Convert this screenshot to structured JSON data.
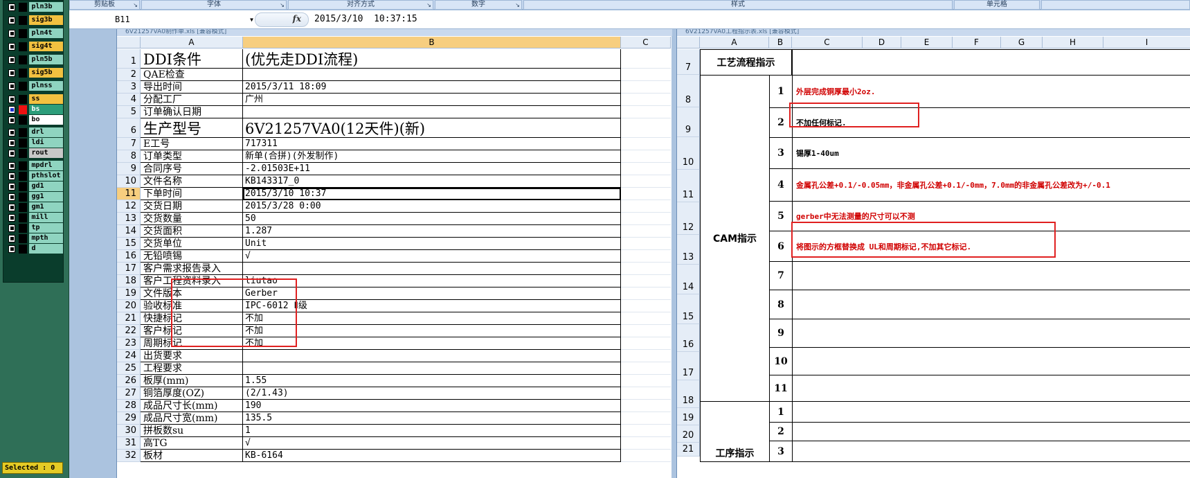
{
  "layers": {
    "items": [
      {
        "name": "pln3b",
        "style": "plain"
      },
      {
        "name": "sig3b",
        "style": "yel"
      },
      {
        "name": "pln4t",
        "style": "plain"
      },
      {
        "name": "sig4t",
        "style": "yel"
      },
      {
        "name": "pln5b",
        "style": "plain"
      },
      {
        "name": "sig5b",
        "style": "yel"
      },
      {
        "name": "plnss",
        "style": "plain"
      },
      {
        "name": "ss",
        "style": "yel"
      },
      {
        "name": "bs",
        "style": "grn"
      },
      {
        "name": "bo",
        "style": "wht"
      },
      {
        "name": "drl",
        "style": "plain"
      },
      {
        "name": "ldi",
        "style": "plain"
      },
      {
        "name": "rout",
        "style": "gry"
      },
      {
        "name": "mpdrl",
        "style": "plain"
      },
      {
        "name": "pthslot",
        "style": "plain"
      },
      {
        "name": "gd1",
        "style": "plain"
      },
      {
        "name": "gg1",
        "style": "plain"
      },
      {
        "name": "gm1",
        "style": "plain"
      },
      {
        "name": "mill",
        "style": "plain"
      },
      {
        "name": "tp",
        "style": "plain"
      },
      {
        "name": "mpth",
        "style": "plain"
      },
      {
        "name": "d",
        "style": "plain"
      }
    ],
    "selected_text": "Selected : 0"
  },
  "ribbon": {
    "groups": [
      "剪贴板",
      "字体",
      "对齐方式",
      "数字",
      "样式",
      "单元格"
    ]
  },
  "formula_bar": {
    "name_box": "B11",
    "fx": "fx",
    "value": "2015/3/10  10:37:15"
  },
  "left_sheet": {
    "window_title": "6V21257VA0制作单.xls  [兼容模式]",
    "columns": [
      "A",
      "B",
      "C"
    ],
    "rows": [
      {
        "n": "1",
        "a": "DDI条件",
        "b": "(优先走DDI流程)",
        "big": true
      },
      {
        "n": "2",
        "a": "QAE检查",
        "b": ""
      },
      {
        "n": "3",
        "a": "导出时间",
        "b": "2015/3/11 18:09"
      },
      {
        "n": "4",
        "a": "分配工厂",
        "b": "广州"
      },
      {
        "n": "5",
        "a": "订单确认日期",
        "b": ""
      },
      {
        "n": "6",
        "a": "生产型号",
        "b": "6V21257VA0(12天件)(新)",
        "big": true
      },
      {
        "n": "7",
        "a": "E工号",
        "b": "717311"
      },
      {
        "n": "8",
        "a": "订单类型",
        "b": "新单(合拼)(外发制作)"
      },
      {
        "n": "9",
        "a": "合同序号",
        "b": "-2.01503E+11"
      },
      {
        "n": "10",
        "a": "文件名称",
        "b": "KB143317_0"
      },
      {
        "n": "11",
        "a": "下单时间",
        "b": "2015/3/10 10:37",
        "sel": true
      },
      {
        "n": "12",
        "a": "交货日期",
        "b": "2015/3/28 0:00"
      },
      {
        "n": "13",
        "a": "交货数量",
        "b": "50"
      },
      {
        "n": "14",
        "a": "交货面积",
        "b": "1.287"
      },
      {
        "n": "15",
        "a": "交货单位",
        "b": "Unit"
      },
      {
        "n": "16",
        "a": "无铅喷锡",
        "b": "√"
      },
      {
        "n": "17",
        "a": "客户需求报告录入",
        "b": ""
      },
      {
        "n": "18",
        "a": "客户工程资料录入",
        "b": "liutao"
      },
      {
        "n": "19",
        "a": "文件版本",
        "b": "Gerber"
      },
      {
        "n": "20",
        "a": "验收标准",
        "b": "IPC-6012 Ⅱ级"
      },
      {
        "n": "21",
        "a": "快捷标记",
        "b": "不加"
      },
      {
        "n": "22",
        "a": "客户标记",
        "b": "不加"
      },
      {
        "n": "23",
        "a": "周期标记",
        "b": "不加"
      },
      {
        "n": "24",
        "a": "出货要求",
        "b": ""
      },
      {
        "n": "25",
        "a": "工程要求",
        "b": ""
      },
      {
        "n": "26",
        "a": "板厚(mm)",
        "b": "1.55"
      },
      {
        "n": "27",
        "a": "铜箔厚度(OZ)",
        "b": "(2/1.43)"
      },
      {
        "n": "28",
        "a": "成品尺寸长(mm)",
        "b": "190"
      },
      {
        "n": "29",
        "a": "成品尺寸宽(mm)",
        "b": "135.5"
      },
      {
        "n": "30",
        "a": "拼板数su",
        "b": "1"
      },
      {
        "n": "31",
        "a": "高TG",
        "b": "√"
      },
      {
        "n": "32",
        "a": "板材",
        "b": "KB-6164"
      }
    ]
  },
  "right_sheet": {
    "window_title": "6V21257VA0工程指示表.xls  [兼容模式]",
    "columns": [
      "A",
      "B",
      "C",
      "D",
      "E",
      "F",
      "G",
      "H",
      "I"
    ],
    "row_numbers": [
      "7",
      "8",
      "9",
      "10",
      "11",
      "12",
      "13",
      "14",
      "15",
      "16",
      "17",
      "18",
      "19",
      "20",
      "21"
    ],
    "header_label": "工艺流程指示",
    "cam_label": "CAM指示",
    "process_label": "工序指示",
    "cam_items": [
      {
        "no": "1",
        "text": "外层完成铜厚最小2oz.",
        "color": "red"
      },
      {
        "no": "2",
        "text": "不加任何标记.",
        "color": "blk"
      },
      {
        "no": "3",
        "text": "锡厚1-40um",
        "color": "blk"
      },
      {
        "no": "4",
        "text": "金属孔公差+0.1/-0.05mm，非金属孔公差+0.1/-0mm，7.0mm的非金属孔公差改为+/-0.1",
        "color": "red"
      },
      {
        "no": "5",
        "text": "gerber中无法测量的尺寸可以不测",
        "color": "red"
      },
      {
        "no": "6",
        "text": "将图示的方框替换成 UL和周期标记,不加其它标记.",
        "color": "red"
      },
      {
        "no": "7",
        "text": "",
        "color": "blk"
      },
      {
        "no": "8",
        "text": "",
        "color": "blk"
      },
      {
        "no": "9",
        "text": "",
        "color": "blk"
      },
      {
        "no": "10",
        "text": "",
        "color": "blk"
      },
      {
        "no": "11",
        "text": "",
        "color": "blk"
      }
    ],
    "process_items": [
      {
        "no": "1"
      },
      {
        "no": "2"
      },
      {
        "no": "3"
      }
    ]
  }
}
